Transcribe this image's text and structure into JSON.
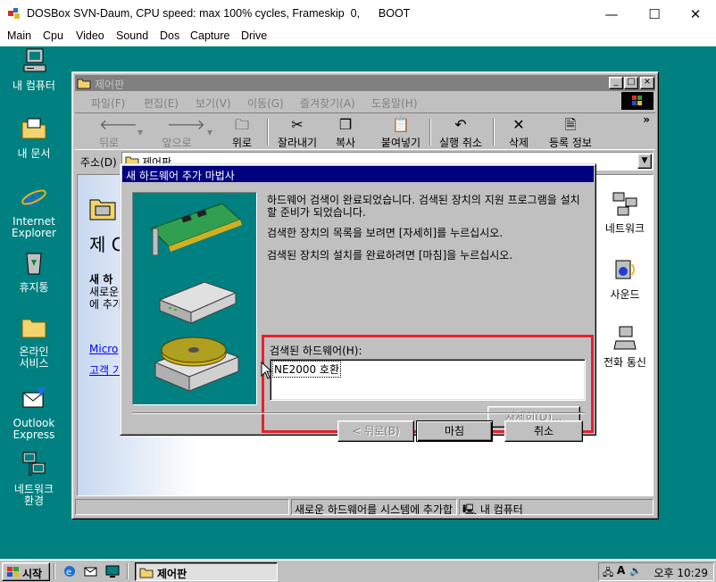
{
  "host": {
    "title": "DOSBox SVN-Daum, CPU speed: max 100% cycles, Frameskip  0,      BOOT",
    "controls": [
      "—",
      "☐",
      "✕"
    ],
    "menu": [
      "Main",
      "Cpu",
      "Video",
      "Sound",
      "Dos",
      "Capture",
      "Drive"
    ]
  },
  "desktop": {
    "icons": [
      {
        "label": "내 컴퓨터",
        "icon": "my-computer-icon"
      },
      {
        "label": "내 문서",
        "icon": "my-documents-icon"
      },
      {
        "label": "Internet\nExplorer",
        "icon": "internet-explorer-icon"
      },
      {
        "label": "휴지통",
        "icon": "recycle-bin-icon"
      },
      {
        "label": "온라인\n서비스",
        "icon": "online-services-icon"
      },
      {
        "label": "Outlook\nExpress",
        "icon": "outlook-express-icon"
      },
      {
        "label": "네트워크\n환경",
        "icon": "network-neighborhood-icon"
      }
    ]
  },
  "control_panel": {
    "title": "제어판",
    "menu": [
      "파일(F)",
      "편집(E)",
      "보기(V)",
      "이동(G)",
      "즐겨찾기(A)",
      "도움말(H)"
    ],
    "toolbar": [
      "뒤로",
      "앞으로",
      "위로",
      "잘라내기",
      "복사",
      "붙여넣기",
      "실행 취소",
      "삭제",
      "등록 정보"
    ],
    "more": "»",
    "address_label": "주소(D)",
    "address_value": "제어판",
    "left_pane": {
      "big_title": "제 C",
      "section_title": "새 하",
      "section_line1": "새로운",
      "section_line2": "에 추가",
      "link1": "Micro",
      "link2": "고객 기"
    },
    "right_items": [
      "네트워크",
      "사운드",
      "전화 통신"
    ],
    "status_text": "새로운 하드웨어를 시스템에 추가합",
    "status_zone": "내 컴퓨터"
  },
  "wizard": {
    "title": "새 하드웨어 추가 마법사",
    "text1": "하드웨어 검색이 완료되었습니다. 검색된 장치의 지원 프로그램을 설치할 준비가 되었습니다.",
    "text2": "검색한 장치의 목록을 보려면 [자세히]를 누르십시오.",
    "text3": "검색된 장치의 설치를 완료하려면 [마침]을 누르십시오.",
    "found_label": "검색된 하드웨어(H):",
    "found_items": [
      "NE2000 호환"
    ],
    "details_button": "자세히(D)...",
    "back_button": "< 뒤로(B)",
    "finish_button": "마침",
    "cancel_button": "취소"
  },
  "taskbar": {
    "start": "시작",
    "task": "제어판",
    "clock": "오후 10:29"
  }
}
